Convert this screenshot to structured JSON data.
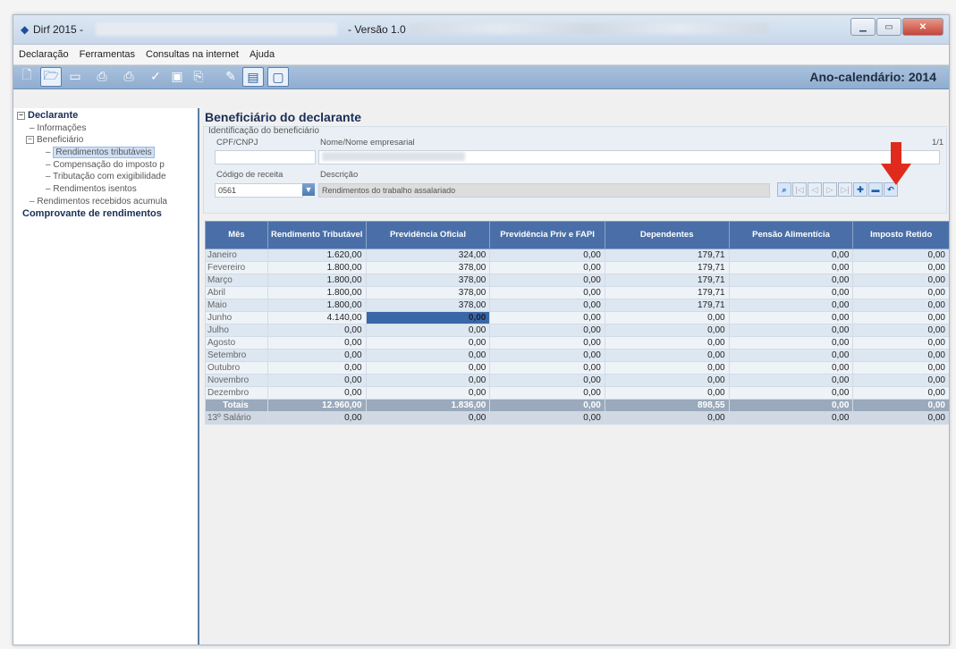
{
  "window": {
    "title": "Dirf 2015 -",
    "version": "- Versão 1.0"
  },
  "menu": [
    "Declaração",
    "Ferramentas",
    "Consultas na internet",
    "Ajuda"
  ],
  "toolbar": {
    "year_label": "Ano-calendário: 2014"
  },
  "tree": {
    "declarante": "Declarante",
    "informacoes": "Informações",
    "beneficiario": "Beneficiário",
    "rend_tributaveis": "Rendimentos tributáveis",
    "compensacao": "Compensação do imposto p",
    "tributacao": "Tributação com exigibilidade",
    "rend_isentos": "Rendimentos isentos",
    "rend_acumul": "Rendimentos recebidos acumula",
    "comprovante": "Comprovante de rendimentos"
  },
  "form": {
    "title": "Beneficiário do declarante",
    "group_label": "Identificação do beneficiário",
    "cpf_label": "CPF/CNPJ",
    "nome_label": "Nome/Nome empresarial",
    "counter": "1/1",
    "codigo_label": "Código de receita",
    "codigo_value": "0561",
    "descricao_label": "Descrição",
    "descricao_value": "Rendimentos do trabalho assalariado"
  },
  "table": {
    "headers": [
      "Mês",
      "Rendimento Tributável",
      "Previdência Oficial",
      "Previdência Priv e FAPI",
      "Dependentes",
      "Pensão Alimentícia",
      "Imposto Retido"
    ],
    "rows": [
      [
        "Janeiro",
        "1.620,00",
        "324,00",
        "0,00",
        "179,71",
        "0,00",
        "0,00"
      ],
      [
        "Fevereiro",
        "1.800,00",
        "378,00",
        "0,00",
        "179,71",
        "0,00",
        "0,00"
      ],
      [
        "Março",
        "1.800,00",
        "378,00",
        "0,00",
        "179,71",
        "0,00",
        "0,00"
      ],
      [
        "Abril",
        "1.800,00",
        "378,00",
        "0,00",
        "179,71",
        "0,00",
        "0,00"
      ],
      [
        "Maio",
        "1.800,00",
        "378,00",
        "0,00",
        "179,71",
        "0,00",
        "0,00"
      ],
      [
        "Junho",
        "4.140,00",
        "0,00",
        "0,00",
        "0,00",
        "0,00",
        "0,00"
      ],
      [
        "Julho",
        "0,00",
        "0,00",
        "0,00",
        "0,00",
        "0,00",
        "0,00"
      ],
      [
        "Agosto",
        "0,00",
        "0,00",
        "0,00",
        "0,00",
        "0,00",
        "0,00"
      ],
      [
        "Setembro",
        "0,00",
        "0,00",
        "0,00",
        "0,00",
        "0,00",
        "0,00"
      ],
      [
        "Outubro",
        "0,00",
        "0,00",
        "0,00",
        "0,00",
        "0,00",
        "0,00"
      ],
      [
        "Novembro",
        "0,00",
        "0,00",
        "0,00",
        "0,00",
        "0,00",
        "0,00"
      ],
      [
        "Dezembro",
        "0,00",
        "0,00",
        "0,00",
        "0,00",
        "0,00",
        "0,00"
      ]
    ],
    "totals": [
      "Totais",
      "12.960,00",
      "1.836,00",
      "0,00",
      "898,55",
      "0,00",
      "0,00"
    ],
    "decimo": [
      "13º Salário",
      "0,00",
      "0,00",
      "0,00",
      "0,00",
      "0,00",
      "0,00"
    ]
  }
}
